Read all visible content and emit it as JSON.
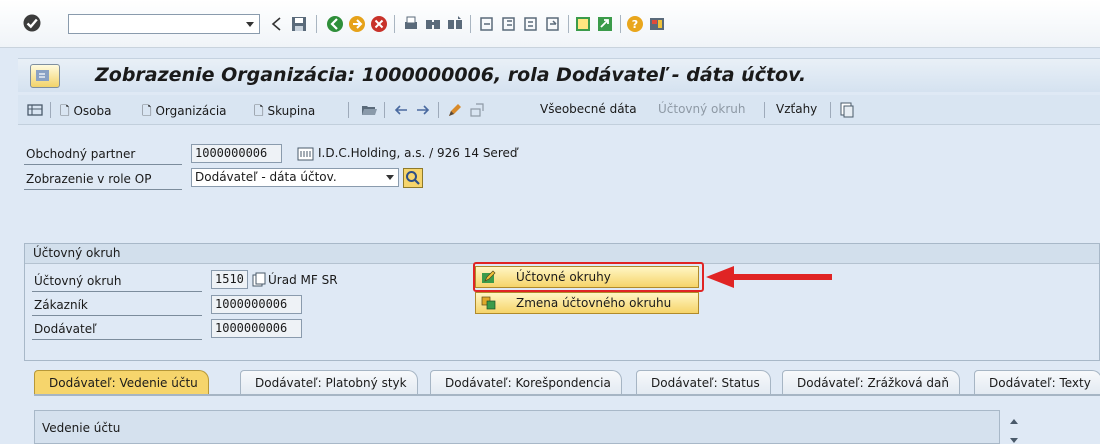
{
  "window": {
    "title": "Zobrazenie Organizácia: 1000000006, rola Dodávateľ - dáta účtov."
  },
  "app_toolbar": {
    "person_label": "Osoba",
    "organization_label": "Organizácia",
    "group_label": "Skupina",
    "general_data_label": "Všeobecné dáta",
    "company_code_label": "Účtovný okruh",
    "relationships_label": "Vzťahy"
  },
  "header": {
    "business_partner_label": "Obchodný partner",
    "business_partner_value": "1000000006",
    "partner_name": "I.D.C.Holding, a.s. / 926 14 Sereď",
    "role_label": "Zobrazenie v role OP",
    "role_value": "Dodávateľ - dáta účtov."
  },
  "company_code_group": {
    "title": "Účtovný okruh",
    "company_code_label": "Účtovný okruh",
    "company_code_value": "1510",
    "company_code_name": "Úrad MF SR",
    "customer_label": "Zákazník",
    "customer_value": "1000000006",
    "vendor_label": "Dodávateľ",
    "vendor_value": "1000000006"
  },
  "popup_menu": {
    "items": [
      {
        "label": "Účtovné okruhy"
      },
      {
        "label": "Zmena účtovného okruhu"
      }
    ]
  },
  "tabs": [
    {
      "label": "Dodávateľ: Vedenie účtu",
      "active": true
    },
    {
      "label": "Dodávateľ: Platobný styk"
    },
    {
      "label": "Dodávateľ: Korešpondencia"
    },
    {
      "label": "Dodávateľ: Status"
    },
    {
      "label": "Dodávateľ: Zrážková daň"
    },
    {
      "label": "Dodávateľ: Texty"
    }
  ],
  "subpanel": {
    "title": "Vedenie účtu"
  },
  "colors": {
    "accent_yellow": "#f6d56c",
    "highlight_red": "#e02424",
    "background": "#dfe9f5"
  }
}
